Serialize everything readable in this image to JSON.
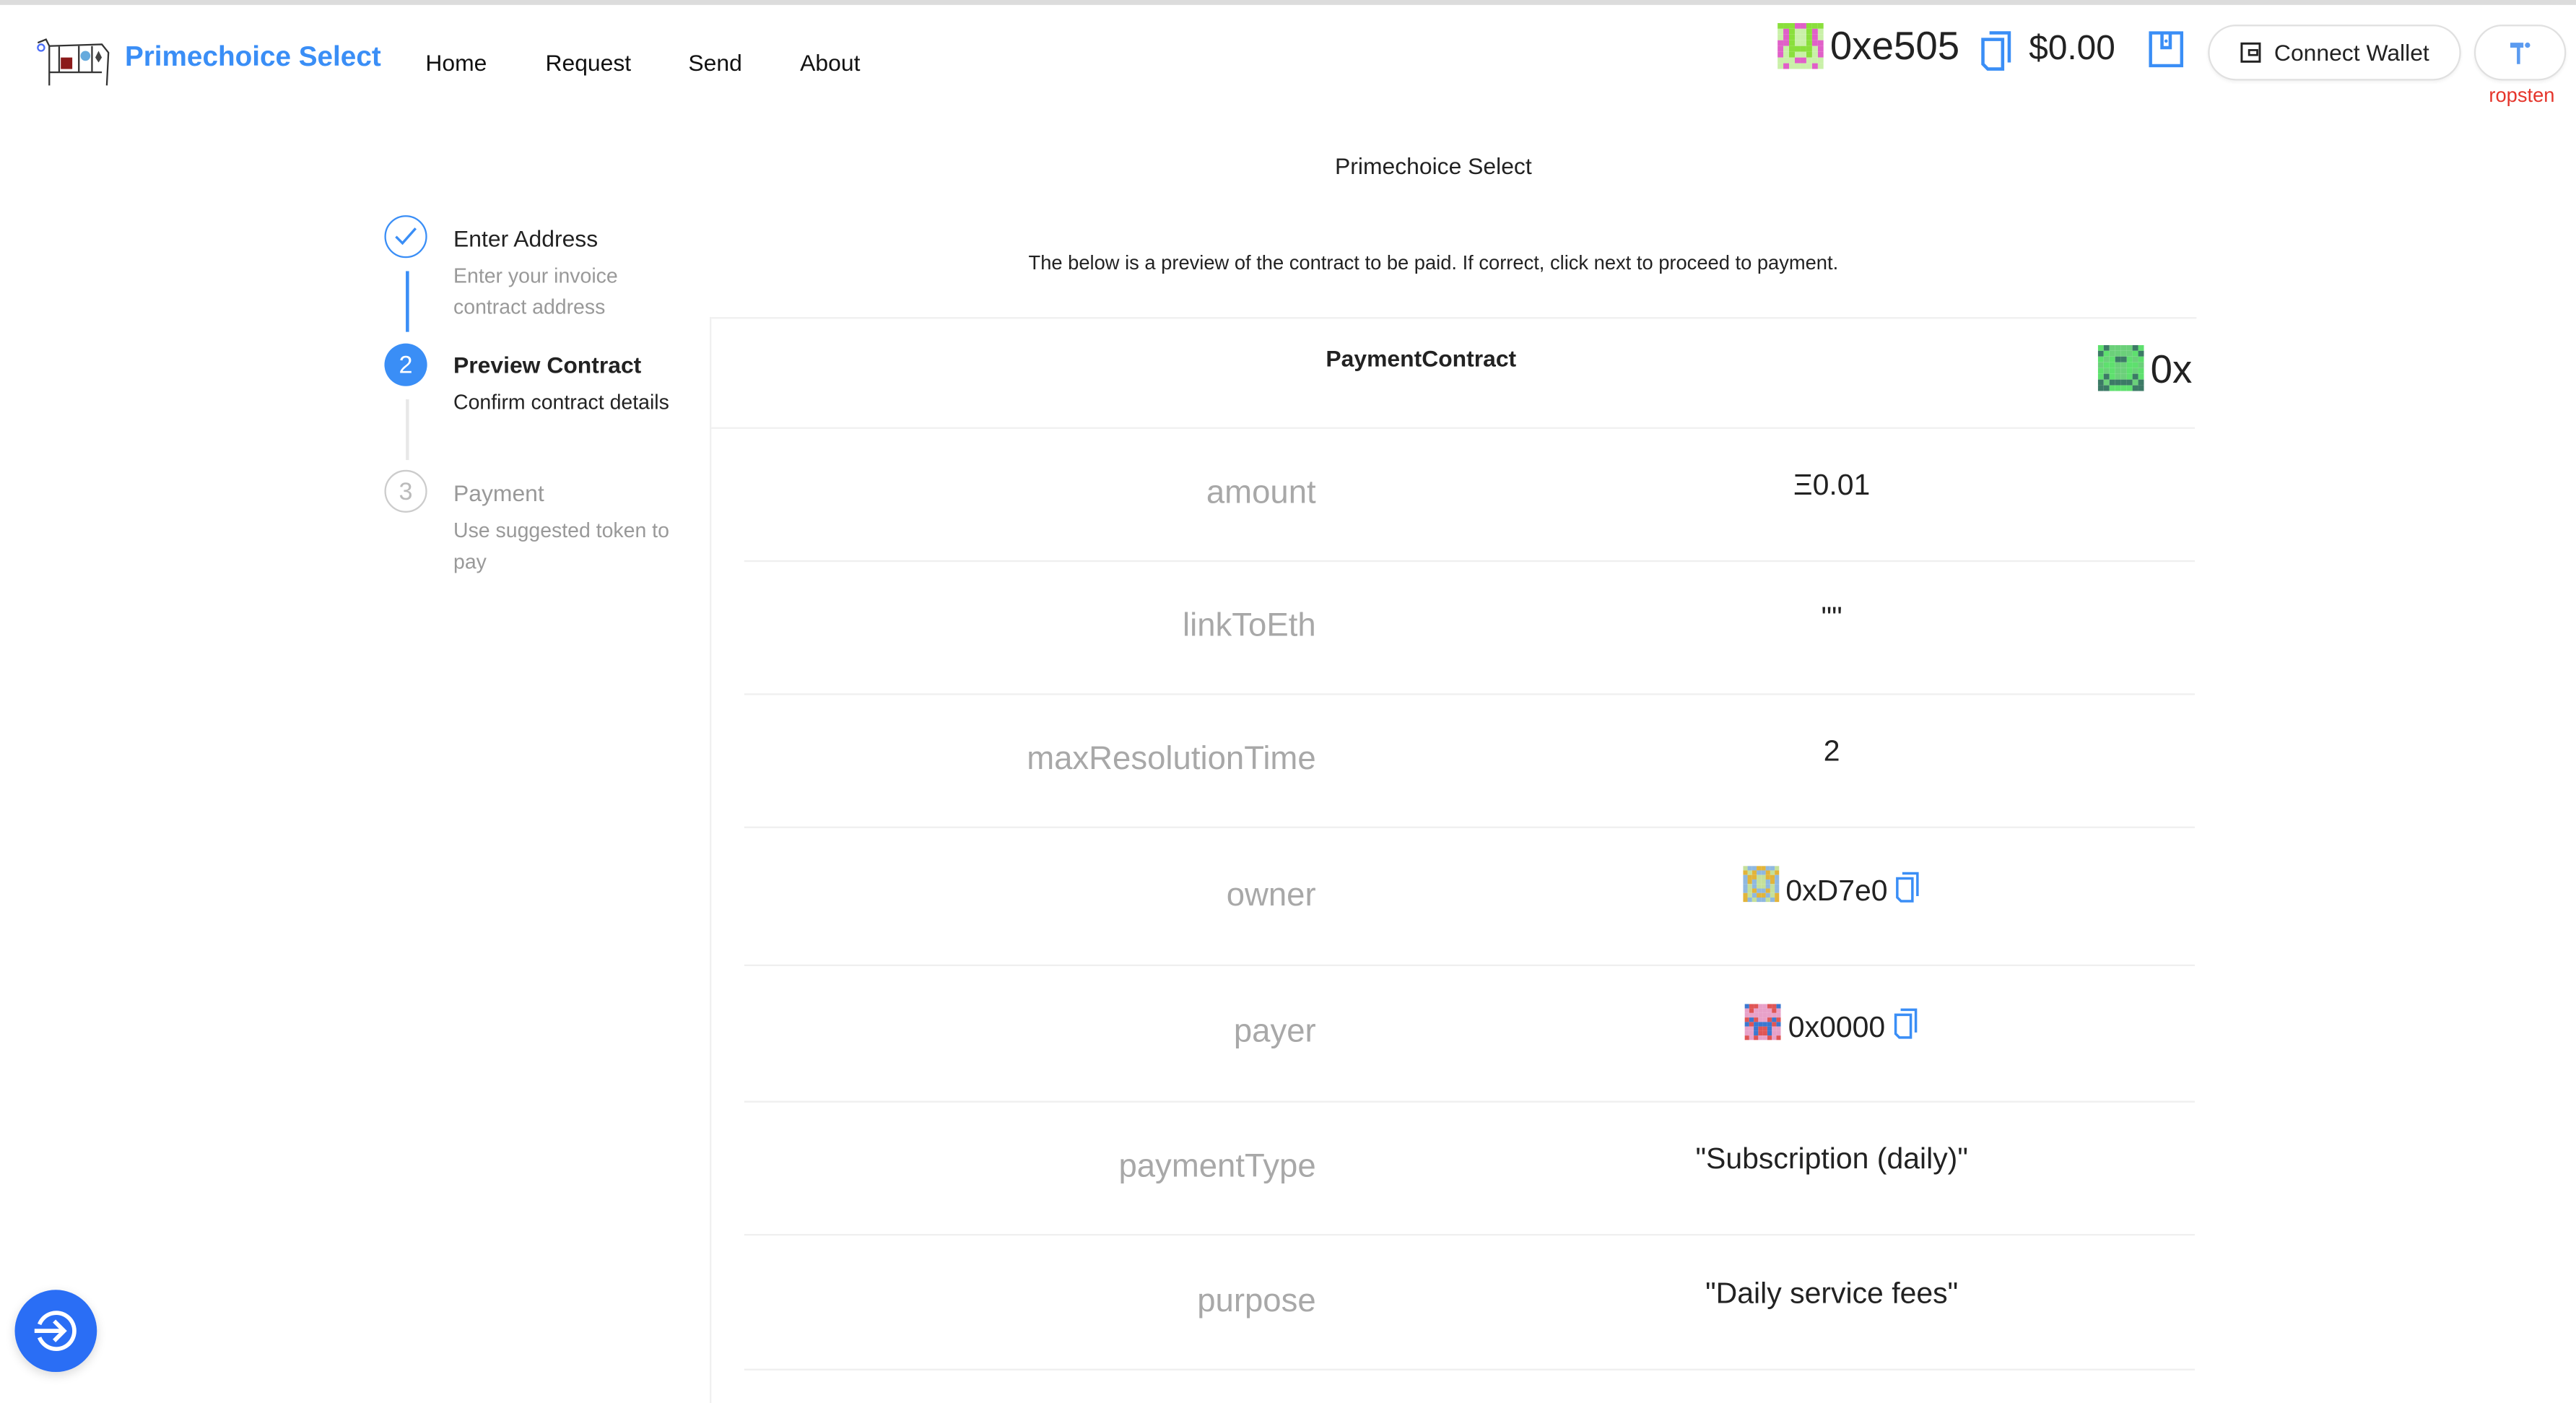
{
  "header": {
    "brand": "Primechoice Select",
    "nav": [
      "Home",
      "Request",
      "Send",
      "About"
    ],
    "account_address": "0xe505",
    "balance": "$0.00",
    "connect_wallet_label": "Connect Wallet",
    "network": "ropsten",
    "brand_color": "#3a8ef6",
    "network_color": "#e5352b"
  },
  "page_title": "Primechoice Select",
  "steps": [
    {
      "number": "1",
      "title": "Enter Address",
      "description": "Enter your invoice contract address",
      "status": "finished"
    },
    {
      "number": "2",
      "title": "Preview Contract",
      "description": "Confirm contract details",
      "status": "current"
    },
    {
      "number": "3",
      "title": "Payment",
      "description": "Use suggested token to pay",
      "status": "waiting"
    }
  ],
  "description": "The below is a preview of the contract to be paid. If correct, click next to proceed to payment.",
  "contract": {
    "name": "PaymentContract",
    "address": "0x",
    "fields": [
      {
        "label": "amount",
        "value": "Ξ0.01"
      },
      {
        "label": "linkToEth",
        "value": "\"\""
      },
      {
        "label": "maxResolutionTime",
        "value": "2"
      },
      {
        "label": "owner",
        "value": "0xD7e0",
        "type": "address"
      },
      {
        "label": "payer",
        "value": "0x0000",
        "type": "address"
      },
      {
        "label": "paymentType",
        "value": "\"Subscription (daily)\""
      },
      {
        "label": "purpose",
        "value": "\"Daily service fees\""
      }
    ]
  },
  "icons": {
    "copy": "copy-icon",
    "wallet": "wallet-icon",
    "fab": "login-arrow-icon",
    "accent": "#2a6ef5"
  }
}
